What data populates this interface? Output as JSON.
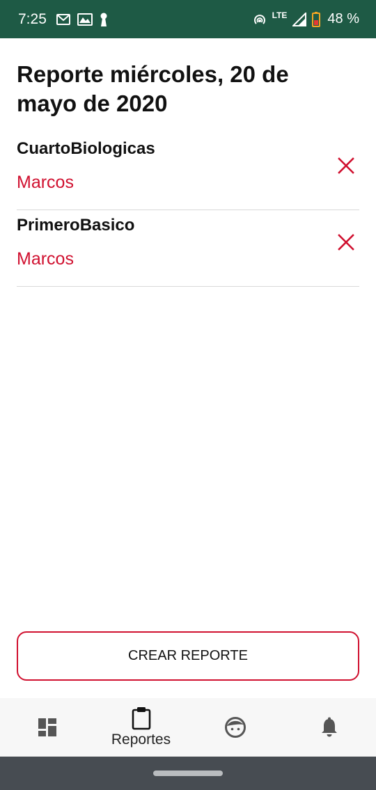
{
  "status_bar": {
    "time": "7:25",
    "network": "LTE",
    "battery": "48 %"
  },
  "page": {
    "title": "Reporte miércoles, 20 de mayo de 2020"
  },
  "reports": [
    {
      "course": "CuartoBiologicas",
      "teacher": "Marcos"
    },
    {
      "course": "PrimeroBasico",
      "teacher": "Marcos"
    }
  ],
  "create_button": {
    "label": "CREAR REPORTE"
  },
  "bottom_nav": {
    "items": [
      {
        "icon": "dashboard-icon",
        "label": ""
      },
      {
        "icon": "clipboard-icon",
        "label": "Reportes"
      },
      {
        "icon": "face-icon",
        "label": ""
      },
      {
        "icon": "bell-icon",
        "label": ""
      }
    ]
  },
  "colors": {
    "status_bar": "#1e5a45",
    "accent": "#d0102f",
    "nav_background": "#f7f7f7",
    "system_nav": "#474c52"
  }
}
